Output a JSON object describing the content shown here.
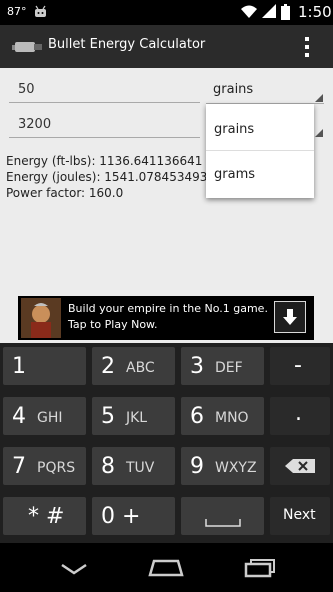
{
  "status_bar": {
    "temperature": "87°",
    "time": "1:50"
  },
  "app_bar": {
    "title": "Bullet Energy Calculator"
  },
  "inputs": {
    "weight_value": "50",
    "weight_unit": "grains",
    "velocity_value": "3200"
  },
  "dropdown": {
    "options": [
      "grains",
      "grams"
    ]
  },
  "results": {
    "energy_ftlbs": "Energy (ft-lbs): 1136.641136641",
    "energy_joules": "Energy (joules): 1541.078453493",
    "power_factor": "Power factor: 160.0"
  },
  "ad": {
    "text": "Build your empire in the No.1 game. Tap to Play Now."
  },
  "keyboard": {
    "keys": [
      {
        "main": "1",
        "sub": ""
      },
      {
        "main": "2",
        "sub": "ABC"
      },
      {
        "main": "3",
        "sub": "DEF"
      },
      {
        "main": "-",
        "sub": ""
      },
      {
        "main": "4",
        "sub": "GHI"
      },
      {
        "main": "5",
        "sub": "JKL"
      },
      {
        "main": "6",
        "sub": "MNO"
      },
      {
        "main": ".",
        "sub": ""
      },
      {
        "main": "7",
        "sub": "PQRS"
      },
      {
        "main": "8",
        "sub": "TUV"
      },
      {
        "main": "9",
        "sub": "WXYZ"
      },
      {
        "main": "* #",
        "sub": ""
      },
      {
        "main": "0 +",
        "sub": ""
      },
      {
        "main": "Next",
        "sub": ""
      }
    ]
  }
}
